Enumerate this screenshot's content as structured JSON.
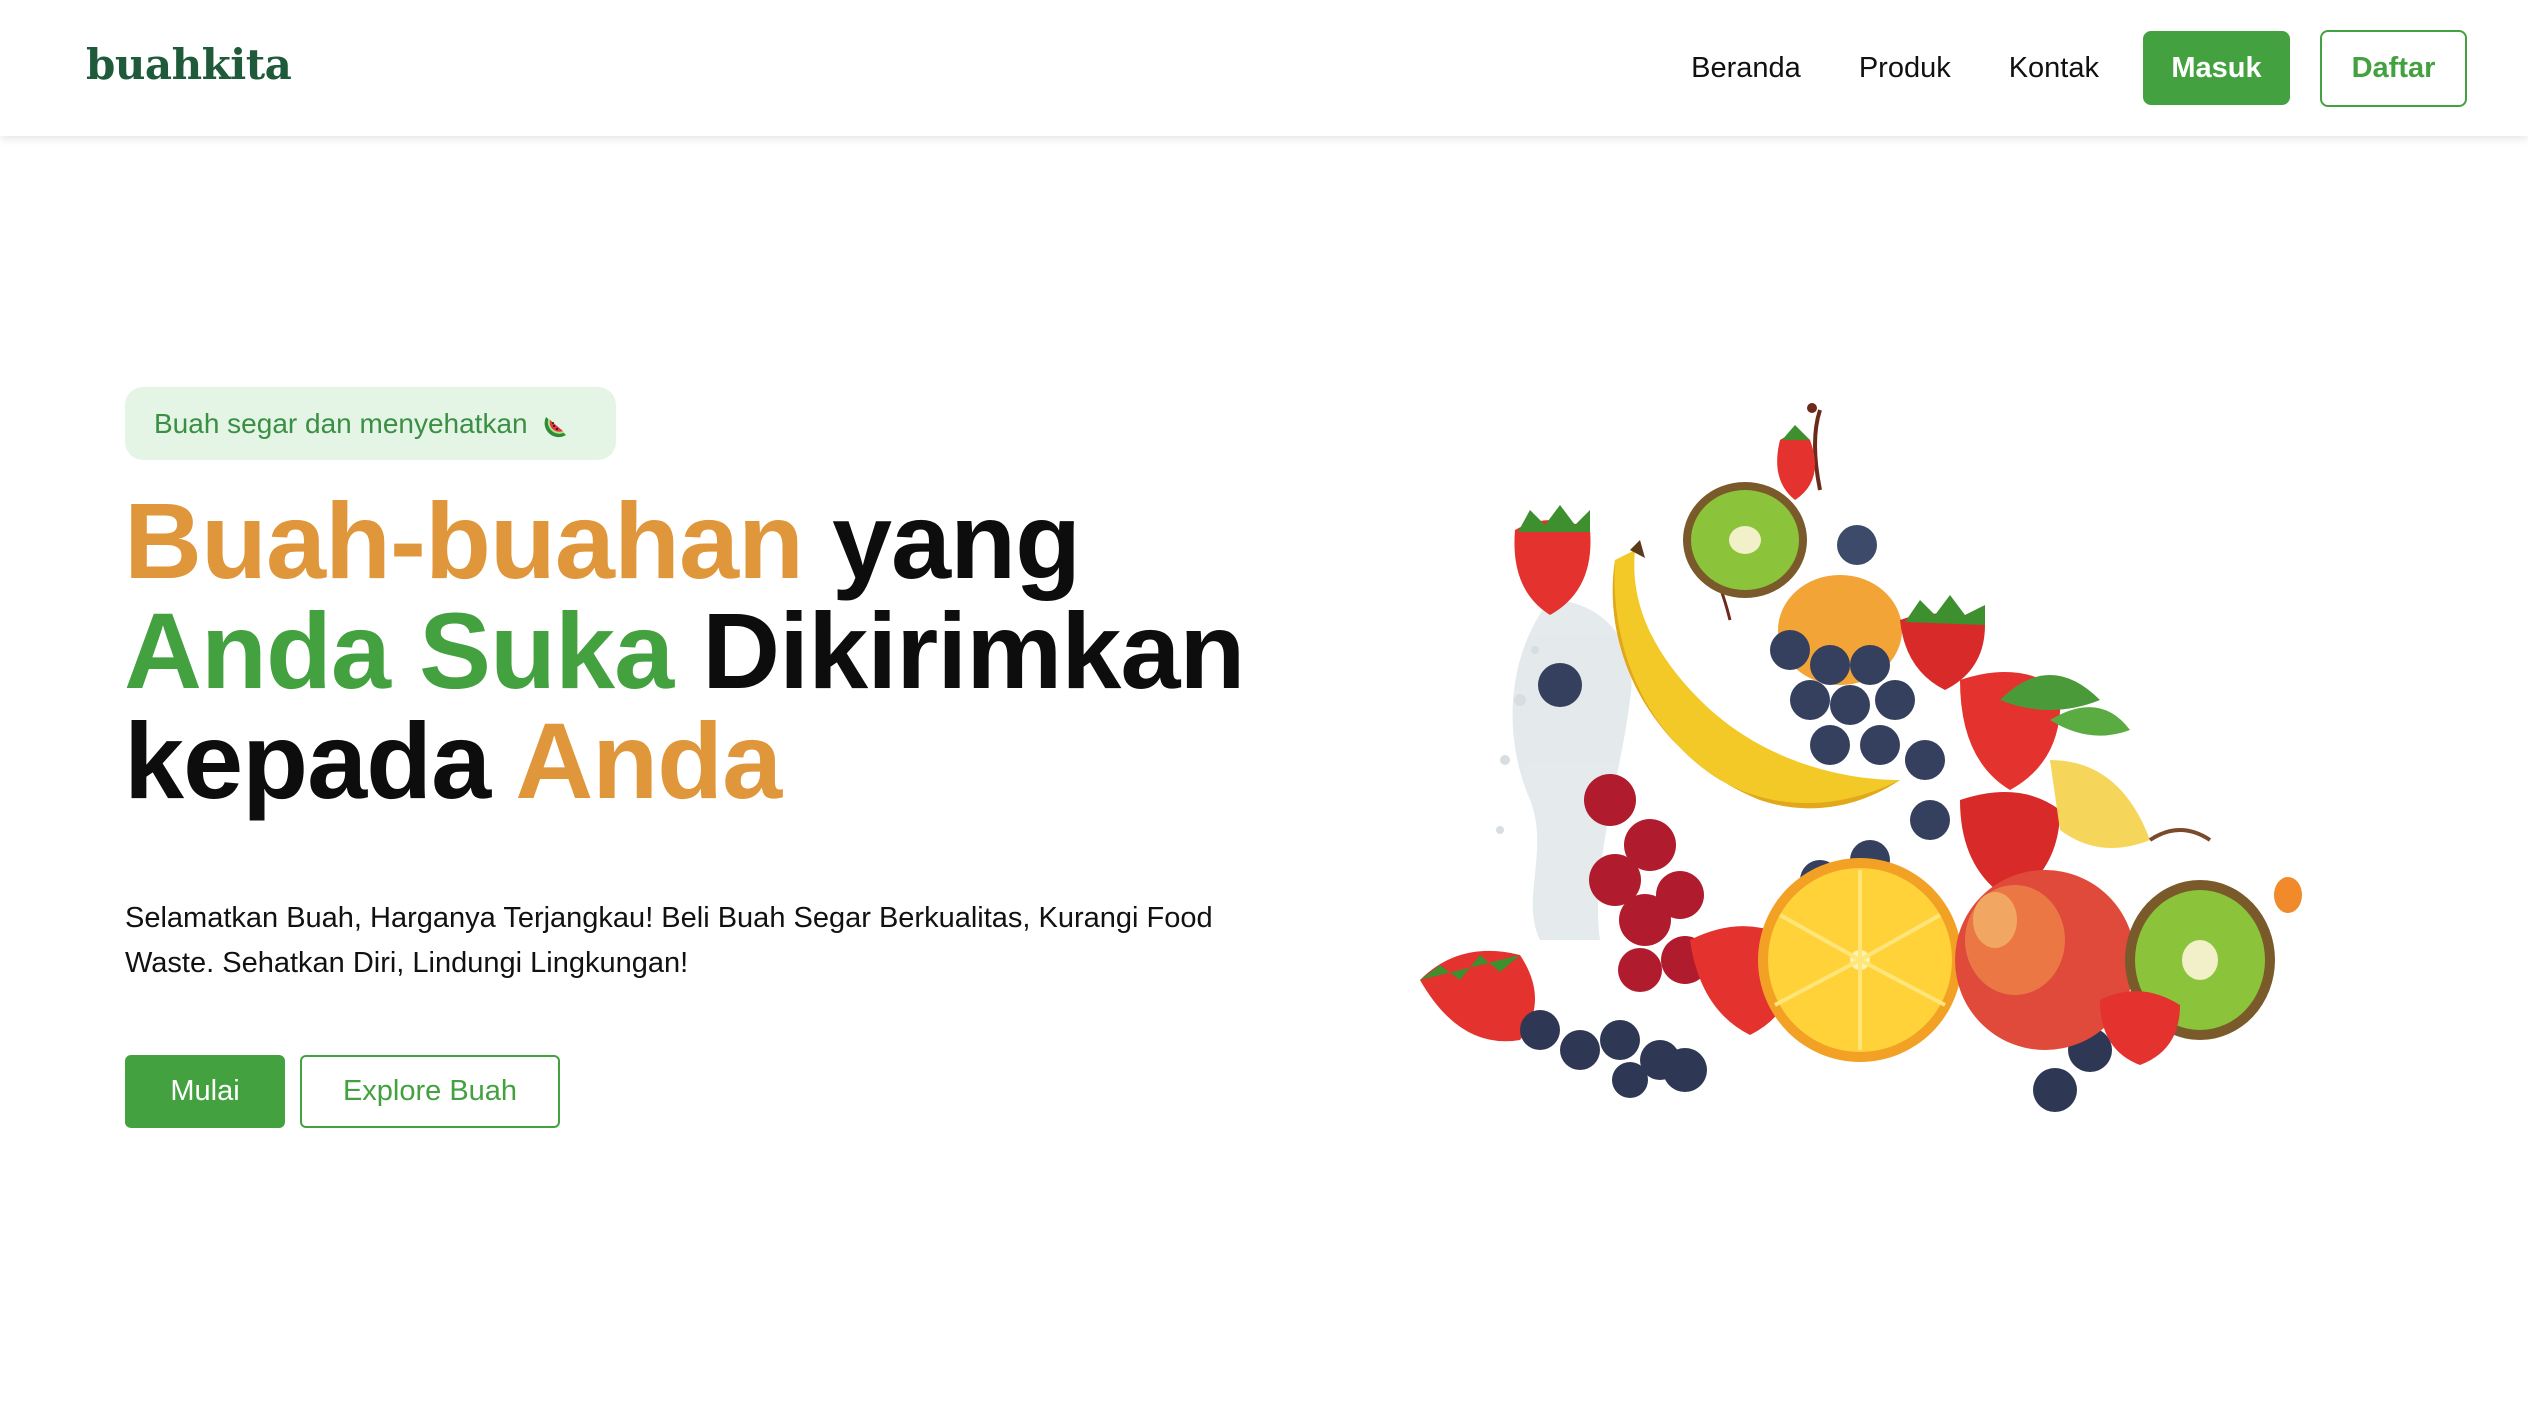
{
  "brand": {
    "logo_text": "buahkita",
    "logo_color": "#1f5a3a"
  },
  "nav": {
    "links": [
      {
        "label": "Beranda"
      },
      {
        "label": "Produk"
      },
      {
        "label": "Kontak"
      }
    ],
    "login_label": "Masuk",
    "register_label": "Daftar"
  },
  "hero": {
    "badge_text": "Buah segar dan menyehatkan",
    "badge_icon": "watermelon-icon",
    "headline": {
      "part1": "Buah-buahan",
      "part2": " yang",
      "part3": "Anda Suka",
      "part4": " Dikirimkan",
      "part5": "kepada ",
      "part6": "Anda"
    },
    "subtext": "Selamatkan Buah, Harganya Terjangkau! Beli Buah Segar Berkualitas, Kurangi Food Waste. Sehatkan Diri, Lindungi Lingkungan!",
    "primary_cta": "Mulai",
    "secondary_cta": "Explore Buah",
    "image_icon": "fruit-pile-illustration"
  },
  "colors": {
    "accent_green": "#43a13f",
    "accent_orange": "#e0963a",
    "badge_bg": "#e4f5e6"
  }
}
